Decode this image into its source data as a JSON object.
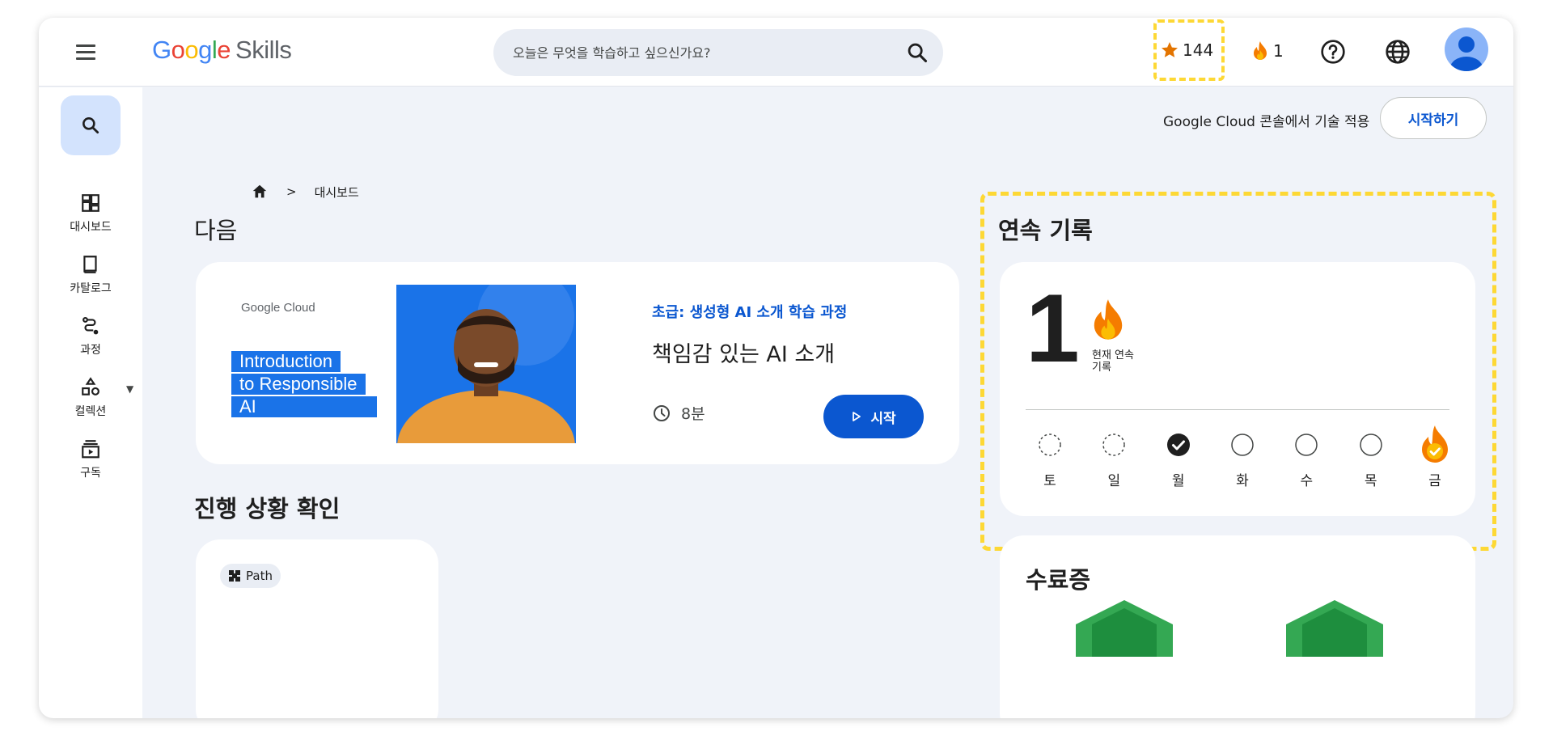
{
  "header": {
    "logo_google": "Google",
    "logo_skills": "Skills",
    "search_placeholder": "오늘은 무엇을 학습하고 싶으신가요?",
    "points": "144",
    "streak": "1"
  },
  "sidebar": {
    "items": [
      {
        "label": "대시보드",
        "icon": "dashboard-icon"
      },
      {
        "label": "카탈로그",
        "icon": "book-icon"
      },
      {
        "label": "과정",
        "icon": "route-icon"
      },
      {
        "label": "컬렉션",
        "icon": "shapes-icon"
      },
      {
        "label": "구독",
        "icon": "subscriptions-icon"
      }
    ]
  },
  "banner": {
    "text": "Google Cloud 콘솔에서 기술 적용",
    "button": "시작하기"
  },
  "breadcrumb": {
    "current": "대시보드"
  },
  "next": {
    "heading": "다음",
    "card": {
      "thumb_logo": "Google Cloud",
      "thumb_lines": [
        "Introduction",
        "to Responsible",
        "AI"
      ],
      "category": "초급: 생성형 AI 소개 학습 과정",
      "title": "책임감 있는 AI 소개",
      "duration": "8분",
      "start": "시작"
    }
  },
  "progress": {
    "heading": "진행 상황 확인",
    "chip": "Path"
  },
  "streak_panel": {
    "heading": "연속 기록",
    "count": "1",
    "label": "현재 연속 기록",
    "days": [
      {
        "label": "토",
        "state": "future-dotted"
      },
      {
        "label": "일",
        "state": "future-dotted"
      },
      {
        "label": "월",
        "state": "done"
      },
      {
        "label": "화",
        "state": "empty"
      },
      {
        "label": "수",
        "state": "empty"
      },
      {
        "label": "목",
        "state": "empty"
      },
      {
        "label": "금",
        "state": "today-flame"
      }
    ]
  },
  "certificates": {
    "heading": "수료증"
  },
  "colors": {
    "primary": "#0b57d0",
    "highlight": "#fdd835",
    "flame": "#f57c00",
    "background": "#f0f3f9"
  }
}
